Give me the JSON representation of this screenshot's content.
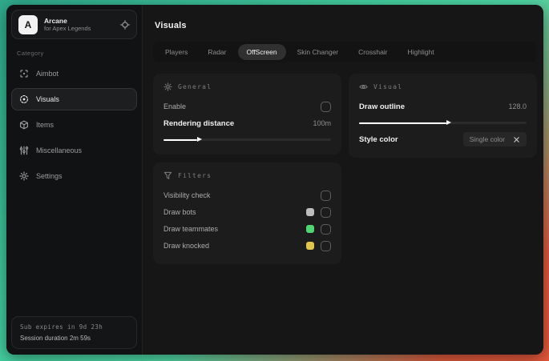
{
  "sidebar": {
    "brand": {
      "logo_letter": "A",
      "title": "Arcane",
      "subtitle": "for Apex Legends"
    },
    "category_label": "Category",
    "items": [
      {
        "label": "Aimbot"
      },
      {
        "label": "Visuals"
      },
      {
        "label": "Items"
      },
      {
        "label": "Miscellaneous"
      },
      {
        "label": "Settings"
      }
    ],
    "footer": {
      "sub_expires": "Sub expires in 9d 23h",
      "session_duration": "Session duration 2m 59s"
    }
  },
  "main": {
    "title": "Visuals",
    "active_tab": "OffScreen",
    "tabs": [
      {
        "label": "Players"
      },
      {
        "label": "Radar"
      },
      {
        "label": "OffScreen"
      },
      {
        "label": "Skin Changer"
      },
      {
        "label": "Crosshair"
      },
      {
        "label": "Highlight"
      }
    ]
  },
  "panels": {
    "general": {
      "header": "General",
      "enable_label": "Enable",
      "enable_checked": false,
      "distance_label": "Rendering distance",
      "distance_value": "100m",
      "distance_fill": "20%"
    },
    "filters": {
      "header": "Filters",
      "rows": [
        {
          "label": "Visibility check",
          "checked": false
        },
        {
          "label": "Draw bots",
          "swatch": "#bdbdbd",
          "checked": false
        },
        {
          "label": "Draw teammates",
          "swatch": "#4fd572",
          "checked": false
        },
        {
          "label": "Draw knocked",
          "swatch": "#e0c44c",
          "checked": false
        }
      ]
    },
    "visual": {
      "header": "Visual",
      "outline_label": "Draw outline",
      "outline_value": "128.0",
      "outline_fill": "52%",
      "style_label": "Style color",
      "style_value": "Single color"
    }
  }
}
